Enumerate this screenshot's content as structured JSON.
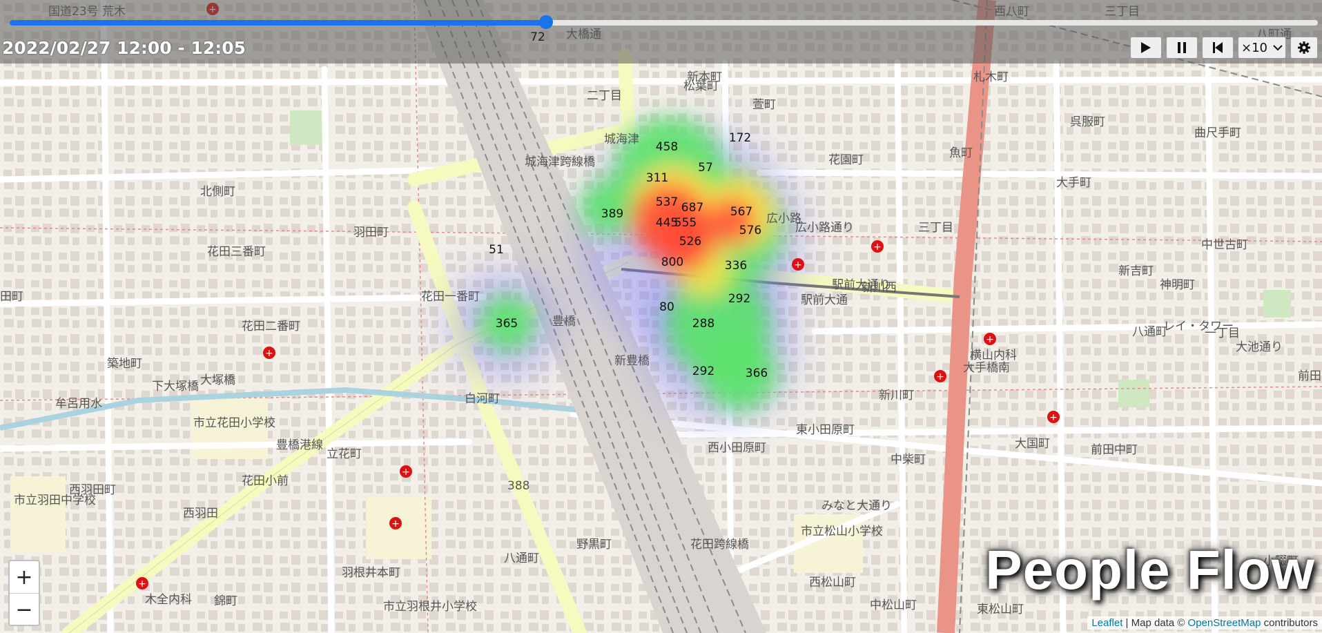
{
  "header": {
    "time_range": "2022/02/27 12:00 - 12:05",
    "slider": {
      "value": 72,
      "value_label": "72",
      "fraction": 0.41
    },
    "speed": "×10"
  },
  "controls": {
    "play": "play-icon",
    "pause": "pause-icon",
    "rewind": "skip-back-icon",
    "settings": "gear-icon"
  },
  "zoom": {
    "in": "+",
    "out": "−"
  },
  "brand": "People Flow",
  "attribution": {
    "leaflet": "Leaflet",
    "sep": " | Map data © ",
    "osm": "OpenStreetMap",
    "tail": " contributors"
  },
  "heat_counts": [
    {
      "label": "458"
    },
    {
      "label": "172"
    },
    {
      "label": "57"
    },
    {
      "label": "311"
    },
    {
      "label": "537"
    },
    {
      "label": "687"
    },
    {
      "label": "567"
    },
    {
      "label": "389"
    },
    {
      "label": "445"
    },
    {
      "label": "555"
    },
    {
      "label": "576"
    },
    {
      "label": "526"
    },
    {
      "label": "51"
    },
    {
      "label": "800"
    },
    {
      "label": "336"
    },
    {
      "label": "292"
    },
    {
      "label": "80"
    },
    {
      "label": "365"
    },
    {
      "label": "288"
    },
    {
      "label": "292"
    },
    {
      "label": "366"
    }
  ],
  "map_labels": [
    "国道23号 荒木",
    "西八町",
    "三丁目",
    "大橋通",
    "八町通",
    "札木町",
    "新本町",
    "松葉町",
    "萱町",
    "二丁目",
    "城海津",
    "城海津跨線橋",
    "花園町",
    "魚町",
    "呉服町",
    "曲尺手町",
    "大手町",
    "北側町",
    "羽田町",
    "広小路",
    "広小路通り",
    "三丁目",
    "花田三番町",
    "中世古町",
    "新吉町",
    "花田一番町",
    "駅前大通り",
    "新川西",
    "神明町",
    "田町",
    "豊橋",
    "駅前大通",
    "花田二番町",
    "一丁目",
    "築地町",
    "新豊橋",
    "大塚橋",
    "下大塚橋",
    "牟呂用水",
    "白河町",
    "新川町",
    "大手橋南",
    "市立花田小学校",
    "東小田原町",
    "大国町",
    "西小田原町",
    "前田中町",
    "立花町",
    "豊橋港線",
    "中柴町",
    "西羽田町",
    "花田小前",
    "388",
    "市立羽田中学校",
    "西羽田",
    "花田跨線橋",
    "野黒町",
    "市立松山小学校",
    "八通町",
    "西松山町",
    "羽根井本町",
    "錦町",
    "木全内科",
    "市立羽根井小学校",
    "中松山町",
    "東松山町",
    "前田",
    "横山内科",
    "レイ・タワー",
    "小畷町",
    "八通町",
    "大池通り",
    "みなと大通り"
  ]
}
